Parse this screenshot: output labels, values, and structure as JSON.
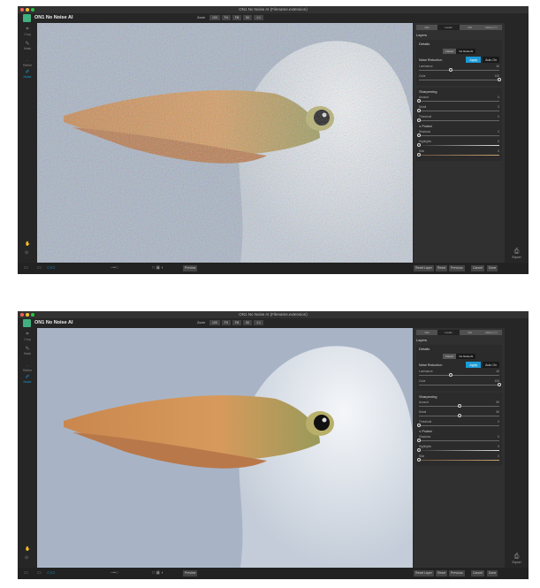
{
  "windows": [
    {
      "title": "ON1 No Noise AI (Filename.extension)",
      "app_name": "ON1 No Noise AI",
      "zoom": {
        "label": "Zoom",
        "value": "100",
        "buttons": [
          "Fit",
          "Fill",
          "50",
          "1:1"
        ]
      },
      "sidebar": [
        "Crop",
        "Mask",
        "Refine",
        "Noise"
      ],
      "tabs": [
        "Nav",
        "Levels",
        "Info",
        "History (*)"
      ],
      "layers_label": "Layers",
      "details_label": "Details",
      "mode": [
        "Classic",
        "No Noise AI"
      ],
      "noise_reduction": {
        "label": "Noise Reduction:",
        "apply": "Apply",
        "auto": "Auto On"
      },
      "noise_sliders": [
        {
          "label": "Luminance",
          "value": 40
        },
        {
          "label": "Color",
          "value": 100
        }
      ],
      "sharpening_label": "Sharpening",
      "sharpen_sliders": [
        {
          "label": "Amount",
          "value": 0
        },
        {
          "label": "Detail",
          "value": 0
        },
        {
          "label": "Threshold",
          "value": 0
        }
      ],
      "protect_label": "∨ Protect",
      "protect_sliders": [
        {
          "label": "Shadows",
          "value": 0
        },
        {
          "label": "Highlights",
          "value": 0
        },
        {
          "label": "Skin",
          "value": 0
        }
      ],
      "export_label": "Export",
      "bottom": {
        "preview": "Preview",
        "reset_layer": "Reset Layer",
        "reset": "Reset",
        "previous": "Previous",
        "cancel": "Cancel",
        "done": "Done"
      },
      "noisy": true
    },
    {
      "title": "ON1 No Noise AI (Filename.extension)",
      "app_name": "ON1 No Noise AI",
      "zoom": {
        "label": "Zoom",
        "value": "100",
        "buttons": [
          "Fit",
          "Fill",
          "50",
          "1:1"
        ]
      },
      "sidebar": [
        "Crop",
        "Mask",
        "Refine",
        "Noise"
      ],
      "tabs": [
        "Nav",
        "Levels",
        "Info",
        "History (*)"
      ],
      "layers_label": "Layers",
      "details_label": "Details",
      "mode": [
        "Classic",
        "No Noise AI"
      ],
      "noise_reduction": {
        "label": "Noise Reduction:",
        "apply": "Apply",
        "auto": "Auto On"
      },
      "noise_sliders": [
        {
          "label": "Luminance",
          "value": 40
        },
        {
          "label": "Color",
          "value": 100
        }
      ],
      "sharpening_label": "Sharpening",
      "sharpen_sliders": [
        {
          "label": "Amount",
          "value": 50
        },
        {
          "label": "Detail",
          "value": 50
        },
        {
          "label": "Threshold",
          "value": 0
        }
      ],
      "protect_label": "∨ Protect",
      "protect_sliders": [
        {
          "label": "Shadows",
          "value": 0
        },
        {
          "label": "Highlights",
          "value": 0
        },
        {
          "label": "Skin",
          "value": 0
        }
      ],
      "export_label": "Export",
      "bottom": {
        "preview": "Preview",
        "reset_layer": "Reset Layer",
        "reset": "Reset",
        "previous": "Previous",
        "cancel": "Cancel",
        "done": "Done"
      },
      "noisy": false
    }
  ]
}
